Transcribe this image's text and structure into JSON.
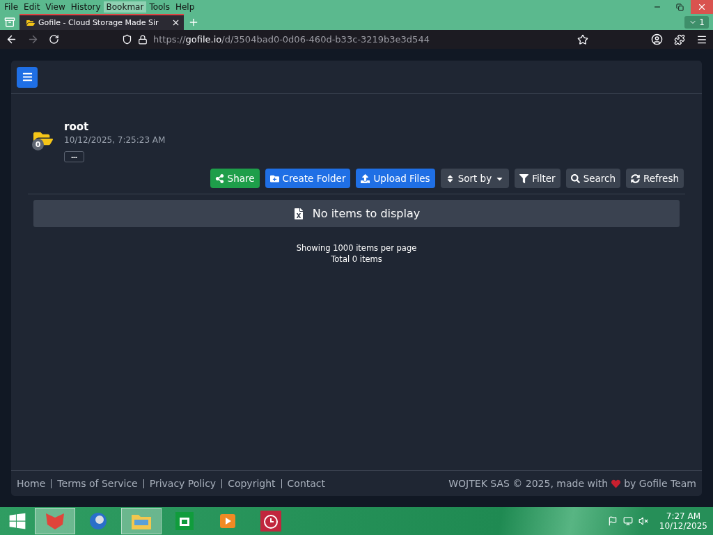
{
  "menu": [
    {
      "label": "File",
      "selected": false
    },
    {
      "label": "Edit",
      "selected": false
    },
    {
      "label": "View",
      "selected": false
    },
    {
      "label": "History",
      "selected": false
    },
    {
      "label": "Bookmar",
      "selected": true
    },
    {
      "label": "Tools",
      "selected": false
    },
    {
      "label": "Help",
      "selected": false
    }
  ],
  "tabs": [
    {
      "title": "Gofile - Cloud Storage Made Sir",
      "selected": true
    }
  ],
  "tab_count": "1",
  "address": {
    "scheme": "https://",
    "host": "gofile.io",
    "path": "/d/3504bad0-0d06-460d-b33c-3219b3e3d544"
  },
  "folder": {
    "name": "root",
    "date": "10/12/2025, 7:25:23 AM",
    "count": "0",
    "more": "•••"
  },
  "toolbar": [
    {
      "label": "Share",
      "kind": "share"
    },
    {
      "label": "Create Folder",
      "kind": "create"
    },
    {
      "label": "Upload Files",
      "kind": "upload"
    },
    {
      "label": "Sort by",
      "kind": "sort"
    },
    {
      "label": "Filter",
      "kind": "filter"
    },
    {
      "label": "Search",
      "kind": "search"
    },
    {
      "label": "Refresh",
      "kind": "refresh"
    }
  ],
  "empty_message": "No items to display",
  "pagination": [
    "Showing 1000 items per page",
    "Total 0 items"
  ],
  "footer": {
    "links": [
      "Home",
      "Terms of Service",
      "Privacy Policy",
      "Copyright",
      "Contact"
    ],
    "credit_before": "WOJTEK SAS © 2025, made with",
    "credit_after": "by Gofile Team"
  },
  "taskbar": {
    "apps": [
      {
        "kind": "fox",
        "selected": true
      },
      {
        "kind": "globe",
        "selected": false
      },
      {
        "kind": "folder",
        "selected": true
      },
      {
        "kind": "store",
        "selected": false
      },
      {
        "kind": "player",
        "selected": false
      },
      {
        "kind": "alarm",
        "selected": false
      }
    ],
    "time": "7:27 AM",
    "date": "10/12/2025"
  }
}
